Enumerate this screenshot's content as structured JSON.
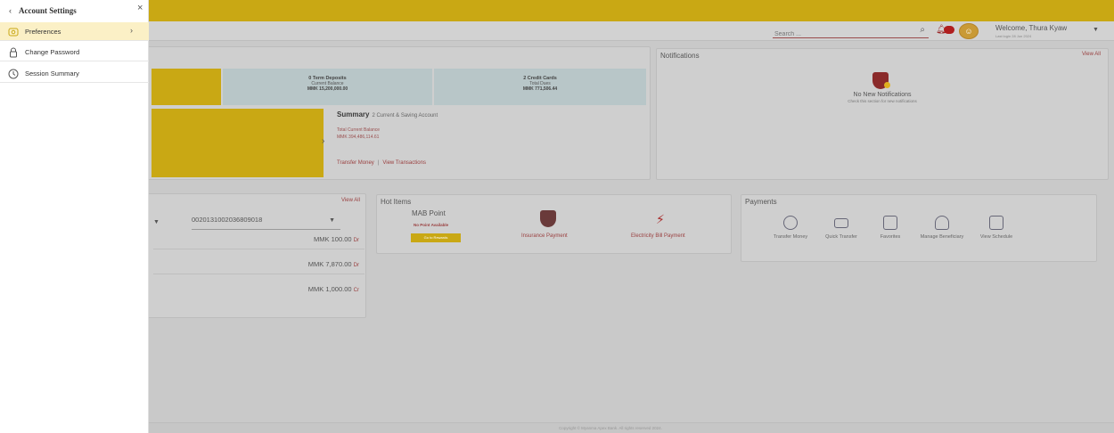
{
  "sidebar": {
    "title": "Account Settings",
    "back_icon": "chevron-left-icon",
    "close_icon": "close-icon",
    "items": [
      {
        "label": "Preferences",
        "icon": "gear-icon",
        "active": true
      },
      {
        "label": "Change Password",
        "icon": "lock-icon",
        "active": false
      },
      {
        "label": "Session Summary",
        "icon": "clock-icon",
        "active": false
      }
    ]
  },
  "header": {
    "search_placeholder": "Search ...",
    "welcome": "Welcome, Thura Kyaw",
    "last_login": "Last login 28 Jun 2024",
    "brand_color": "#c9a814"
  },
  "accounts": {
    "term_deposits": {
      "title": "0 Term Deposits",
      "label": "Current Balance",
      "amount": "MMK 15,200,000.00"
    },
    "credit_cards": {
      "title": "2 Credit Cards",
      "label": "Total Dues",
      "amount": "MMK 771,506.44"
    },
    "summary": {
      "title": "Summary",
      "subtitle": "2 Current & Saving Account",
      "balance_label": "Total Current Balance",
      "balance": "MMK 394,486,114.61",
      "transfer_link": "Transfer Money",
      "separator": "|",
      "transactions_link": "View Transactions"
    }
  },
  "notifications": {
    "title": "Notifications",
    "view_all": "View All",
    "empty_title": "No New Notifications",
    "empty_sub": "Check this section for new notifications"
  },
  "transactions": {
    "view_all": "View All",
    "account_number": "0020131002036809018",
    "rows": [
      {
        "amount": "MMK 100.00",
        "suffix": "Dr"
      },
      {
        "amount": "MMK 7,870.00",
        "suffix": "Dr"
      },
      {
        "amount": "MMK 1,000.00",
        "suffix": "Cr"
      }
    ]
  },
  "hot_items": {
    "title": "Hot Items",
    "mab_title": "MAB Point",
    "mab_sub": "No Point Available",
    "mab_button": "Go to Rewards",
    "insurance": "Insurance Payment",
    "electricity": "Electricity Bill Payment"
  },
  "payments": {
    "title": "Payments",
    "items": [
      {
        "label": "Transfer Money",
        "icon": "transfer-icon"
      },
      {
        "label": "Quick Transfer",
        "icon": "wallet-icon"
      },
      {
        "label": "Favorites",
        "icon": "favorites-icon"
      },
      {
        "label": "Manage Beneficiary",
        "icon": "beneficiary-icon"
      },
      {
        "label": "View Schedule",
        "icon": "schedule-icon"
      }
    ]
  },
  "footer": {
    "text": "Copyright © Myanma Apex Bank. All rights reserved 2024."
  }
}
